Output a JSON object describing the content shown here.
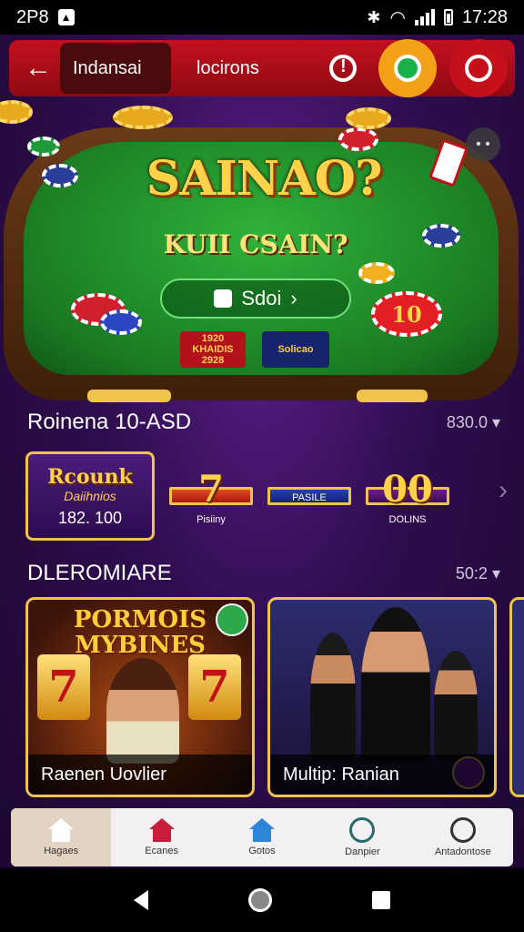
{
  "status_bar": {
    "time_left": "2P8",
    "time_right": "17:28"
  },
  "nav": {
    "tabs": [
      {
        "label": "Indansai",
        "active": true
      },
      {
        "label": "locirons",
        "active": false
      }
    ]
  },
  "hero": {
    "title": "SAINAO?",
    "subtitle": "KUII CSAIN?",
    "pill_text": "Sdoi",
    "card_red_top": "1920",
    "card_red_mid": "KHAIDIS",
    "card_red_bottom": "2928",
    "card_blue": "Solicao",
    "chip_value": "10"
  },
  "section1": {
    "title": "Roinena 10-ASD",
    "meta": "830.0",
    "tiles": [
      {
        "title": "Rcounk",
        "subtitle": "Daiihnios",
        "value": "182. 100"
      },
      {
        "big": "7",
        "small": "Pisiiny"
      },
      {
        "small": "PASILE"
      },
      {
        "big": "00",
        "small": "DOLINS"
      }
    ]
  },
  "section2": {
    "title": "DLEROMIARE",
    "meta": "50:2",
    "cards": [
      {
        "title": "PORMOIS MYBINES",
        "label": "Raenen Uovlier"
      },
      {
        "label": "Multip: Ranian"
      }
    ]
  },
  "bottom_nav": {
    "items": [
      {
        "label": "Hagaes",
        "active": true
      },
      {
        "label": "Ecanes",
        "active": false
      },
      {
        "label": "Gotos",
        "active": false
      },
      {
        "label": "Danpier",
        "active": false
      },
      {
        "label": "Antadontose",
        "active": false
      }
    ]
  },
  "colors": {
    "nav_red": "#c3111e",
    "accent_gold": "#f0c34a",
    "bg_purple": "#2f0d4f",
    "felt_green": "#2fb23a"
  }
}
